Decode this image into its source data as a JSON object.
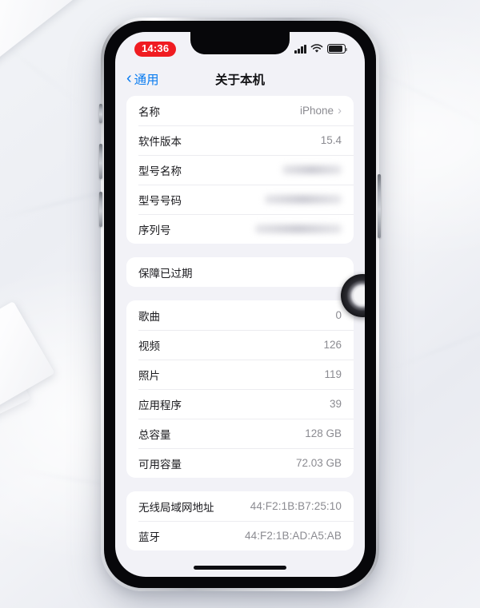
{
  "scene": {
    "description": "iPhone on a light marble desk showing the Settings > General > About screen in Chinese"
  },
  "status_bar": {
    "recording_time": "14:36",
    "icons": [
      "cellular-signal-icon",
      "wifi-icon",
      "battery-icon"
    ]
  },
  "nav_bar": {
    "back_label": "通用",
    "back_icon": "chevron-left-icon",
    "title": "关于本机"
  },
  "sections": [
    {
      "name": "device-info",
      "rows": [
        {
          "label": "名称",
          "value": "iPhone",
          "accessory": "chevron-right-icon",
          "redacted": false
        },
        {
          "label": "软件版本",
          "value": "15.4",
          "accessory": "",
          "redacted": false
        },
        {
          "label": "型号名称",
          "value": "",
          "accessory": "",
          "redacted": true,
          "redact_width": "red-w1"
        },
        {
          "label": "型号号码",
          "value": "",
          "accessory": "",
          "redacted": true,
          "redact_width": "red-w2"
        },
        {
          "label": "序列号",
          "value": "",
          "accessory": "",
          "redacted": true,
          "redact_width": "red-w3"
        }
      ]
    },
    {
      "name": "coverage",
      "rows": [
        {
          "label": "保障已过期",
          "value": "",
          "accessory": "",
          "redacted": false
        }
      ]
    },
    {
      "name": "storage-and-media",
      "rows": [
        {
          "label": "歌曲",
          "value": "0",
          "accessory": "",
          "redacted": false
        },
        {
          "label": "视频",
          "value": "126",
          "accessory": "",
          "redacted": false
        },
        {
          "label": "照片",
          "value": "119",
          "accessory": "",
          "redacted": false
        },
        {
          "label": "应用程序",
          "value": "39",
          "accessory": "",
          "redacted": false
        },
        {
          "label": "总容量",
          "value": "128 GB",
          "accessory": "",
          "redacted": false
        },
        {
          "label": "可用容量",
          "value": "72.03 GB",
          "accessory": "",
          "redacted": false
        }
      ]
    },
    {
      "name": "network-addresses",
      "rows": [
        {
          "label": "无线局域网地址",
          "value": "44:F2:1B:B7:25:10",
          "accessory": "",
          "redacted": false
        },
        {
          "label": "蓝牙",
          "value": "44:F2:1B:AD:A5:AB",
          "accessory": "",
          "redacted": false
        }
      ]
    }
  ],
  "overlay": {
    "lens_indicator": "camera-lens-ring"
  },
  "colors": {
    "accent_blue": "#0a7cf0",
    "recording_red": "#f01c21",
    "screen_background": "#f2f2f7",
    "card_background": "#ffffff",
    "label_text": "#1a1a1e",
    "value_text": "#8b8b91"
  }
}
